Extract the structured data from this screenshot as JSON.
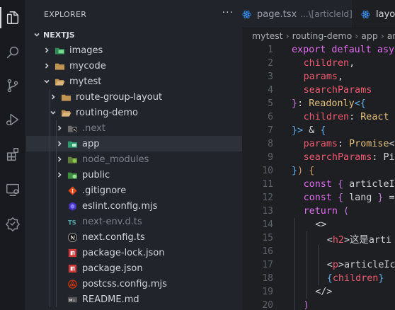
{
  "sidebar": {
    "title": "EXPLORER",
    "more": "···",
    "section": "NEXTJS",
    "items": [
      {
        "label": "images",
        "type": "folder-images",
        "expanded": false,
        "depth": 1
      },
      {
        "label": "mycode",
        "type": "folder",
        "expanded": false,
        "depth": 1
      },
      {
        "label": "mytest",
        "type": "folder-open",
        "expanded": true,
        "depth": 1
      },
      {
        "label": "route-group-layout",
        "type": "folder",
        "expanded": false,
        "depth": 2
      },
      {
        "label": "routing-demo",
        "type": "folder-open",
        "expanded": true,
        "depth": 2
      },
      {
        "label": ".next",
        "type": "folder-next",
        "expanded": false,
        "depth": 3,
        "dim": true
      },
      {
        "label": "app",
        "type": "folder-app",
        "expanded": false,
        "depth": 3,
        "selected": true
      },
      {
        "label": "node_modules",
        "type": "folder-node",
        "expanded": false,
        "depth": 3,
        "dim": true
      },
      {
        "label": "public",
        "type": "folder-public",
        "expanded": false,
        "depth": 3
      },
      {
        "label": ".gitignore",
        "type": "git",
        "depth": 3
      },
      {
        "label": "eslint.config.mjs",
        "type": "eslint",
        "depth": 3
      },
      {
        "label": "next-env.d.ts",
        "type": "ts",
        "depth": 3,
        "dim": true
      },
      {
        "label": "next.config.ts",
        "type": "next",
        "depth": 3
      },
      {
        "label": "package-lock.json",
        "type": "npm",
        "depth": 3
      },
      {
        "label": "package.json",
        "type": "npm",
        "depth": 3
      },
      {
        "label": "postcss.config.mjs",
        "type": "postcss",
        "depth": 3
      },
      {
        "label": "README.md",
        "type": "md",
        "depth": 3
      }
    ]
  },
  "tabs": [
    {
      "label": "page.tsx",
      "description": "...\\[articleId]",
      "active": false
    },
    {
      "label": "layout.tsx",
      "description": "",
      "active": true
    }
  ],
  "breadcrumb": [
    "mytest",
    "routing-demo",
    "app",
    "ar"
  ],
  "editor": {
    "lines": [
      {
        "n": "1",
        "code": [
          [
            "kw",
            "export default asy"
          ]
        ],
        "indent": 0
      },
      {
        "n": "2",
        "code": [
          [
            "prop",
            "children"
          ],
          [
            "pun",
            ","
          ]
        ],
        "indent": 1
      },
      {
        "n": "3",
        "code": [
          [
            "prop",
            "params"
          ],
          [
            "pun",
            ","
          ]
        ],
        "indent": 1
      },
      {
        "n": "4",
        "code": [
          [
            "prop",
            "searchParams"
          ]
        ],
        "indent": 1
      },
      {
        "n": "5",
        "code": [
          [
            "br2",
            "}"
          ],
          [
            "pun",
            ": "
          ],
          [
            "ty",
            "Readonly"
          ],
          [
            "br3",
            "<{"
          ]
        ],
        "indent": 0
      },
      {
        "n": "6",
        "code": [
          [
            "prop",
            "children"
          ],
          [
            "pun",
            ": "
          ],
          [
            "ty",
            "React"
          ]
        ],
        "indent": 1
      },
      {
        "n": "7",
        "code": [
          [
            "br3",
            "}>"
          ],
          [
            "pun",
            " & "
          ],
          [
            "br3",
            "{"
          ]
        ],
        "indent": 0
      },
      {
        "n": "8",
        "code": [
          [
            "prop",
            "params"
          ],
          [
            "pun",
            ": "
          ],
          [
            "ty",
            "Promise"
          ],
          [
            "pun",
            "<"
          ]
        ],
        "indent": 1
      },
      {
        "n": "9",
        "code": [
          [
            "prop",
            "searchParams"
          ],
          [
            "pun",
            ": Pi"
          ]
        ],
        "indent": 1
      },
      {
        "n": "10",
        "code": [
          [
            "br3",
            "}"
          ],
          [
            "br1",
            ")"
          ],
          [
            "pun",
            " "
          ],
          [
            "br1",
            "{"
          ]
        ],
        "indent": 0
      },
      {
        "n": "11",
        "code": [
          [
            "kw",
            "const"
          ],
          [
            "pun",
            " "
          ],
          [
            "br2",
            "{"
          ],
          [
            "pun",
            " articleI"
          ]
        ],
        "indent": 1
      },
      {
        "n": "12",
        "code": [
          [
            "kw",
            "const"
          ],
          [
            "pun",
            " "
          ],
          [
            "br2",
            "{"
          ],
          [
            "pun",
            " lang "
          ],
          [
            "br2",
            "}"
          ],
          [
            "pun",
            " ="
          ]
        ],
        "indent": 1
      },
      {
        "n": "13",
        "code": [
          [
            "kw",
            "return"
          ],
          [
            "pun",
            " "
          ],
          [
            "br2",
            "("
          ]
        ],
        "indent": 1
      },
      {
        "n": "14",
        "code": [
          [
            "pun",
            "<>"
          ]
        ],
        "indent": 2
      },
      {
        "n": "15",
        "code": [
          [
            "pun",
            "<"
          ],
          [
            "tag",
            "h2"
          ],
          [
            "pun",
            ">这是arti"
          ]
        ],
        "indent": 3
      },
      {
        "n": "16",
        "code": [],
        "indent": 3
      },
      {
        "n": "17",
        "code": [
          [
            "pun",
            "<"
          ],
          [
            "tag",
            "p"
          ],
          [
            "pun",
            ">articleIc"
          ]
        ],
        "indent": 3
      },
      {
        "n": "18",
        "code": [
          [
            "br3",
            "{"
          ],
          [
            "prop",
            "children"
          ],
          [
            "br3",
            "}"
          ]
        ],
        "indent": 3
      },
      {
        "n": "19",
        "code": [
          [
            "pun",
            "</>"
          ]
        ],
        "indent": 2
      },
      {
        "n": "20",
        "code": [
          [
            "br2",
            ")"
          ]
        ],
        "indent": 1
      }
    ]
  },
  "colors": {
    "accent_blue": "#3794ff",
    "folder_yellow": "#c09553",
    "keyword": "#e06cef",
    "property": "#ef596f",
    "type": "#e5c07b"
  }
}
